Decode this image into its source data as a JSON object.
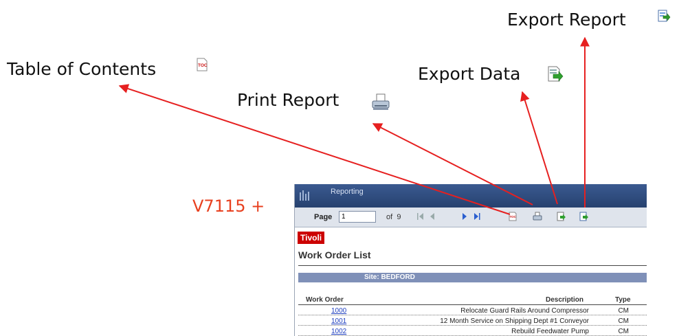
{
  "callouts": {
    "export_report": "Export Report",
    "table_of_contents": "Table of Contents",
    "export_data": "Export Data",
    "print_report": "Print Report",
    "version": "V7115 +"
  },
  "app": {
    "title": "Reporting",
    "toolbar": {
      "page_label": "Page",
      "page_value": "1",
      "of_label": "of",
      "total_pages": "9",
      "toc_glyph": "TOC"
    },
    "brand": "Tivoli",
    "report_title": "Work Order List",
    "site_label": "Site: BEDFORD",
    "columns": [
      "Work Order",
      "Description",
      "Type"
    ],
    "rows": [
      {
        "wo": "1000",
        "desc": "Relocate Guard Rails Around Compressor",
        "type": "CM"
      },
      {
        "wo": "1001",
        "desc": "12 Month Service on Shipping Dept #1 Conveyor",
        "type": "CM"
      },
      {
        "wo": "1002",
        "desc": "Rebuild Feedwater Pump",
        "type": "CM"
      }
    ]
  },
  "colors": {
    "arrow": "#e62020",
    "titlebar": "#2b4a7e",
    "toolbar": "#dfe4ec",
    "brand": "#cc0000",
    "site_band": "#7f90b8",
    "link": "#1f3fbf",
    "version": "#e8401f"
  }
}
